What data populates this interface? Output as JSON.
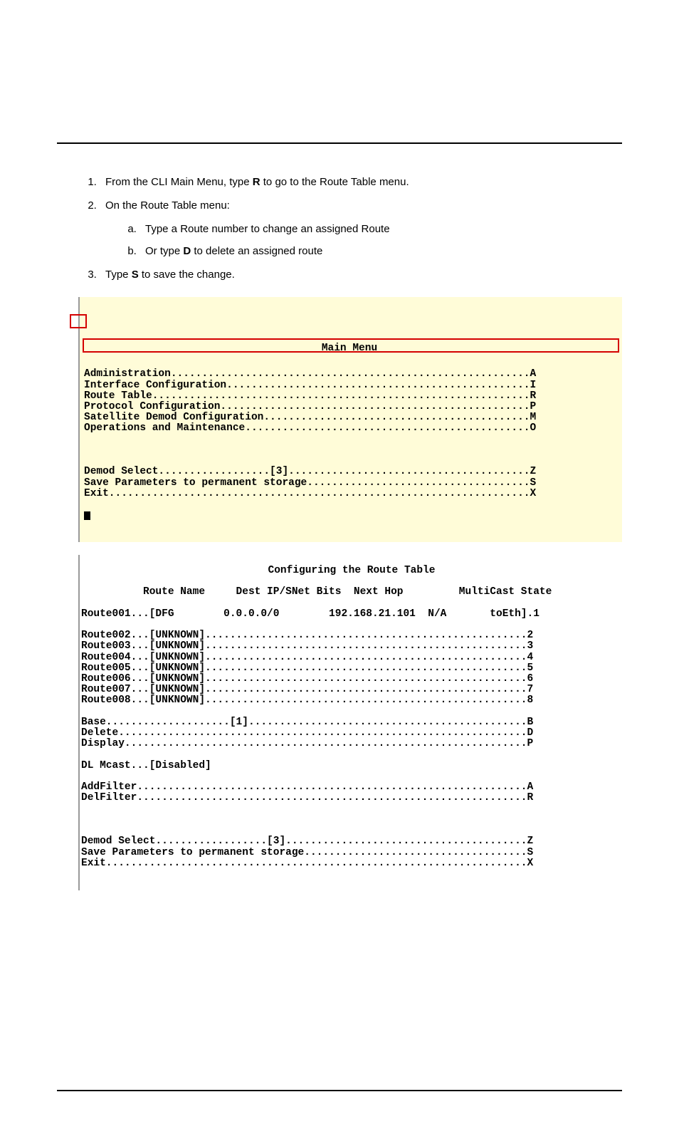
{
  "instructions": {
    "step1_pre": "From the CLI Main Menu, type ",
    "step1_key": "R",
    "step1_post": " to go to the Route Table menu.",
    "step2": "On the Route Table menu:",
    "step2a": "Type a Route number to change an assigned Route",
    "step2b_pre": "Or type ",
    "step2b_key": "D",
    "step2b_post": " to delete an assigned route",
    "step3_pre": "Type ",
    "step3_key": "S",
    "step3_post": " to save the change."
  },
  "main_menu": {
    "title": "Main Menu",
    "items": [
      {
        "label": "Administration",
        "key": "A"
      },
      {
        "label": "Interface Configuration",
        "key": "I"
      },
      {
        "label": "Route Table",
        "key": "R"
      },
      {
        "label": "Protocol Configuration",
        "key": "P"
      },
      {
        "label": "Satellite Demod Configuration",
        "key": "M"
      },
      {
        "label": "Operations and Maintenance",
        "key": "O"
      }
    ],
    "footer": [
      {
        "label": "Demod Select",
        "mid": "[3]",
        "key": "Z"
      },
      {
        "label": "Save Parameters to permanent storage",
        "key": "S"
      },
      {
        "label": "Exit",
        "key": "X"
      }
    ]
  },
  "route_table": {
    "title": "Configuring the Route Table",
    "headers": {
      "name": "Route Name",
      "dest": "Dest IP/SNet Bits",
      "nexthop": "Next Hop",
      "mcast": "MultiCast",
      "state": "State"
    },
    "route1": {
      "id": "Route001",
      "name": "[DFG",
      "dest": "0.0.0.0/0",
      "nexthop": "192.168.21.101",
      "mcast": "N/A",
      "state": "toEth]",
      "key": "1"
    },
    "routes": [
      {
        "id": "Route002",
        "name": "[UNKNOWN]",
        "key": "2"
      },
      {
        "id": "Route003",
        "name": "[UNKNOWN]",
        "key": "3"
      },
      {
        "id": "Route004",
        "name": "[UNKNOWN]",
        "key": "4"
      },
      {
        "id": "Route005",
        "name": "[UNKNOWN]",
        "key": "5"
      },
      {
        "id": "Route006",
        "name": "[UNKNOWN]",
        "key": "6"
      },
      {
        "id": "Route007",
        "name": "[UNKNOWN]",
        "key": "7"
      },
      {
        "id": "Route008",
        "name": "[UNKNOWN]",
        "key": "8"
      }
    ],
    "actions": [
      {
        "label": "Base",
        "mid": "[1]",
        "key": "B"
      },
      {
        "label": "Delete",
        "key": "D"
      },
      {
        "label": "Display",
        "key": "P"
      }
    ],
    "dlmcast": {
      "label": "DL Mcast",
      "val": "[Disabled]"
    },
    "filters": [
      {
        "label": "AddFilter",
        "key": "A"
      },
      {
        "label": "DelFilter",
        "key": "R"
      }
    ],
    "footer": [
      {
        "label": "Demod Select",
        "mid": "[3]",
        "key": "Z"
      },
      {
        "label": "Save Parameters to permanent storage",
        "key": "S"
      },
      {
        "label": "Exit",
        "key": "X"
      }
    ]
  }
}
